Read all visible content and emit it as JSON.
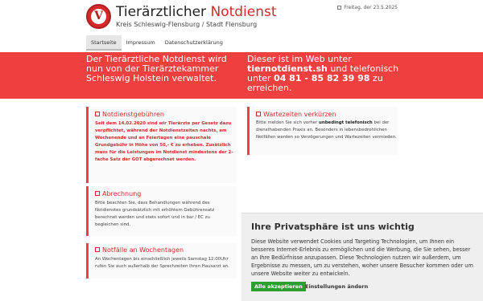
{
  "header": {
    "title_part1": "Tierärztlicher ",
    "title_part2": "Notdienst",
    "subtitle": "Kreis Schleswig-Flensburg / Stadt Flensburg",
    "date": "Freitag, der 23.5.2025",
    "logo_letter": "V"
  },
  "nav": {
    "items": [
      {
        "label": "Startseite"
      },
      {
        "label": "Impressum"
      },
      {
        "label": "Datenschutzerklärung"
      }
    ]
  },
  "banner": {
    "left": "Der Tierärztliche Notdienst wird nun von der Tierärztekammer Schleswig Holstein verwaltet.",
    "right_prefix": "Dieser ist im Web unter",
    "right_site": "tiernotdienst.sh",
    "right_mid": " und telefonisch unter ",
    "right_phone": "04 81 - 85 82 39 98",
    "right_suffix": " zu erreichen."
  },
  "cards": {
    "gebuehren": {
      "title": "Notdienstgebühren",
      "text": "Seit dem 14.02.2020 sind wir Tierärzte per Gesetz dazu verpflichtet, während der Notdienstzeiten nachts, am Wochenende und an Feiertagen eine pauschale Grundgebühr in Höhe von 50,- € zu erheben. Zusätzlich muss für die Leistungen im Notdienst mindestens der 2-fache Satz der GOT abgerechnet werden."
    },
    "abrechnung": {
      "title": "Abrechnung",
      "text": "Bitte beachten Sie, dass Behandlungen während des Notdienstes grundsätzlich mit erhöhtem Gebührensatz berechnet werden und stets sofort und in bar / EC zu begleichen sind."
    },
    "wochentagen": {
      "title": "Notfälle an Wochentagen",
      "text": "An Wochentagen bis einschließlich jeweils Samstag 12:00Uhr rufen Sie auch außerhalb der Sprechzeiten Ihren Hausarzt an."
    },
    "wartezeiten": {
      "title": "Wartezeiten verkürzen",
      "text_pre": "Bitte melden Sie sich vorher ",
      "text_bold": "unbedingt telefonisch",
      "text_post": " bei der diensthabenden Praxis an. Besonders in lebensbedrohlichen Notfällen werden so Verzögerungen und Wartezeiten vermieden."
    }
  },
  "privacy": {
    "title": "Ihre Privatsphäre ist uns wichtig",
    "text": "Diese Website verwendet Cookies und Targeting Technologien, um Ihnen ein besseres Internet-Erlebnis zu ermöglichen und die Werbung, die Sie sehen, besser an Ihre Bedürfnisse anzupassen. Diese Technologien nutzen wir außerdem, um Ergebnisse zu messen, um zu verstehen, woher unsere Besucher kommen oder um unsere Website weiter zu entwickeln.",
    "accept_label": "Alle akzeptieren",
    "settings_label": "Einstellungen ändern"
  },
  "colors": {
    "accent": "#ef4040",
    "brand_red": "#d42a2a",
    "accept_green": "#2e9e2e"
  }
}
